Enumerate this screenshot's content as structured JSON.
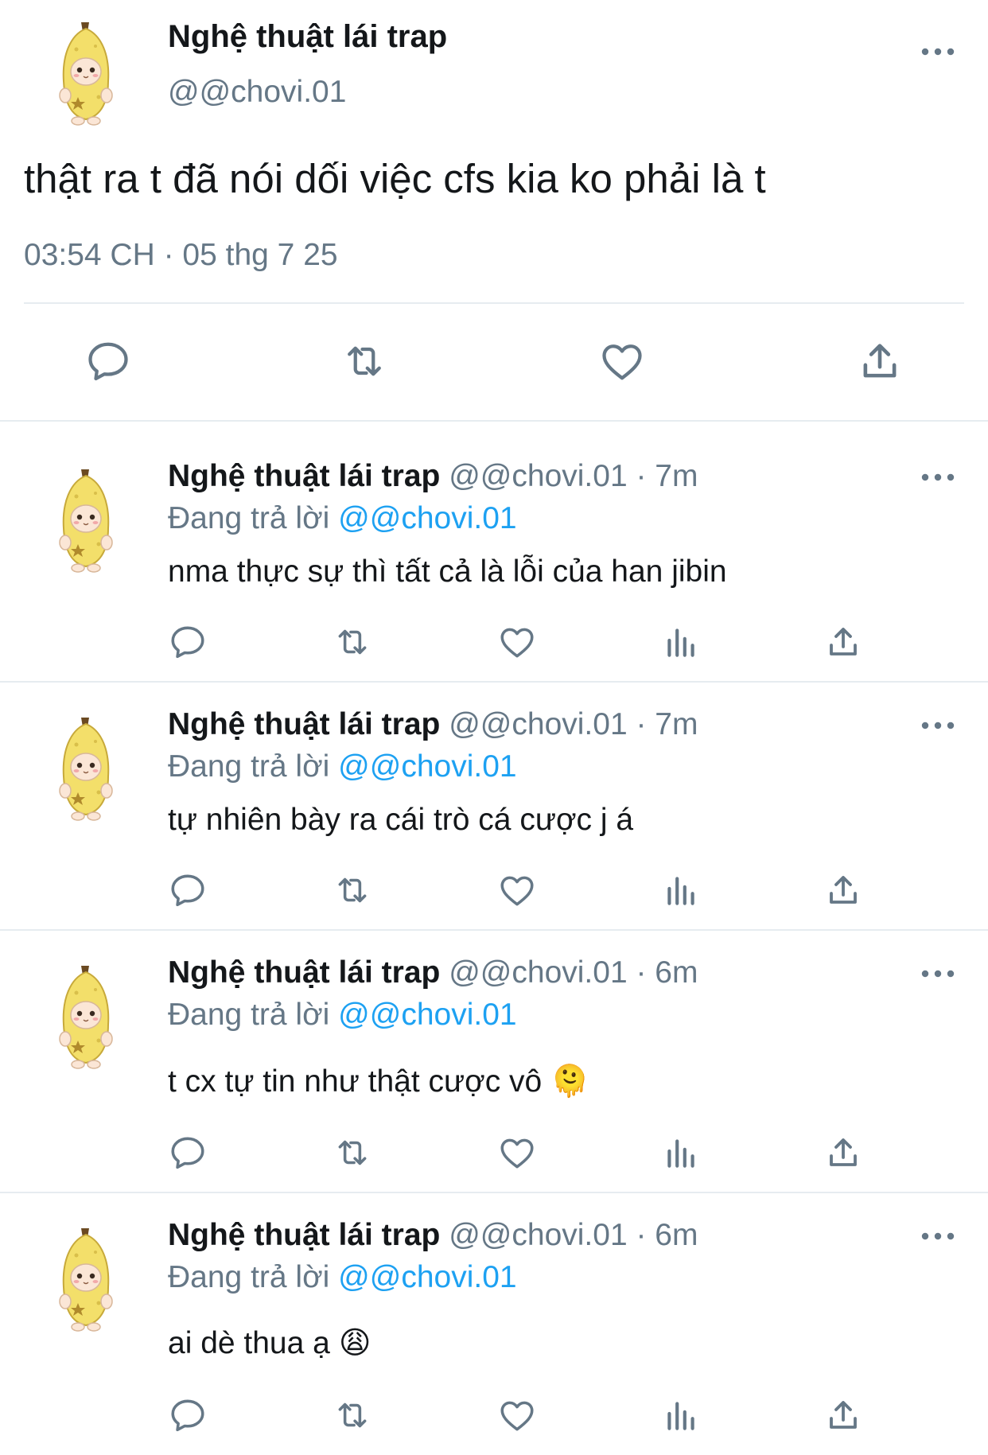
{
  "main_tweet": {
    "author_name": "Nghệ thuật lái trap",
    "handle": "@@chovi.01",
    "text": "thật ra t đã nói dối việc cfs kia ko phải là t",
    "timestamp": "03:54 CH · 05 thg 7 25"
  },
  "replies": [
    {
      "author_name": "Nghệ thuật lái trap",
      "handle_time": "@@chovi.01 · 7m",
      "replying_prefix": "Đang trả lời",
      "replying_to": "@@chovi.01",
      "text": "nma thực sự thì tất cả là lỗi của han jibin"
    },
    {
      "author_name": "Nghệ thuật lái trap",
      "handle_time": "@@chovi.01 · 7m",
      "replying_prefix": "Đang trả lời",
      "replying_to": "@@chovi.01",
      "text": "tự nhiên bày ra cái trò cá cược j á"
    },
    {
      "author_name": "Nghệ thuật lái trap",
      "handle_time": "@@chovi.01 · 6m",
      "replying_prefix": "Đang trả lời",
      "replying_to": "@@chovi.01",
      "text": "t cx tự tin như thật cược vô",
      "emoji": "🫠"
    },
    {
      "author_name": "Nghệ thuật lái trap",
      "handle_time": "@@chovi.01 · 6m",
      "replying_prefix": "Đang trả lời",
      "replying_to": "@@chovi.01",
      "text": "ai dè thua ạ",
      "emoji": "😩"
    }
  ],
  "icons": {
    "reply": "reply-icon",
    "retweet": "retweet-icon",
    "like": "heart-icon",
    "views": "views-icon",
    "share": "share-icon",
    "more": "more-icon",
    "avatar": "banana-cat-avatar"
  },
  "colors": {
    "text": "#14171a",
    "secondary": "#657786",
    "link": "#1da1f2",
    "divider": "#e6ecf0"
  }
}
